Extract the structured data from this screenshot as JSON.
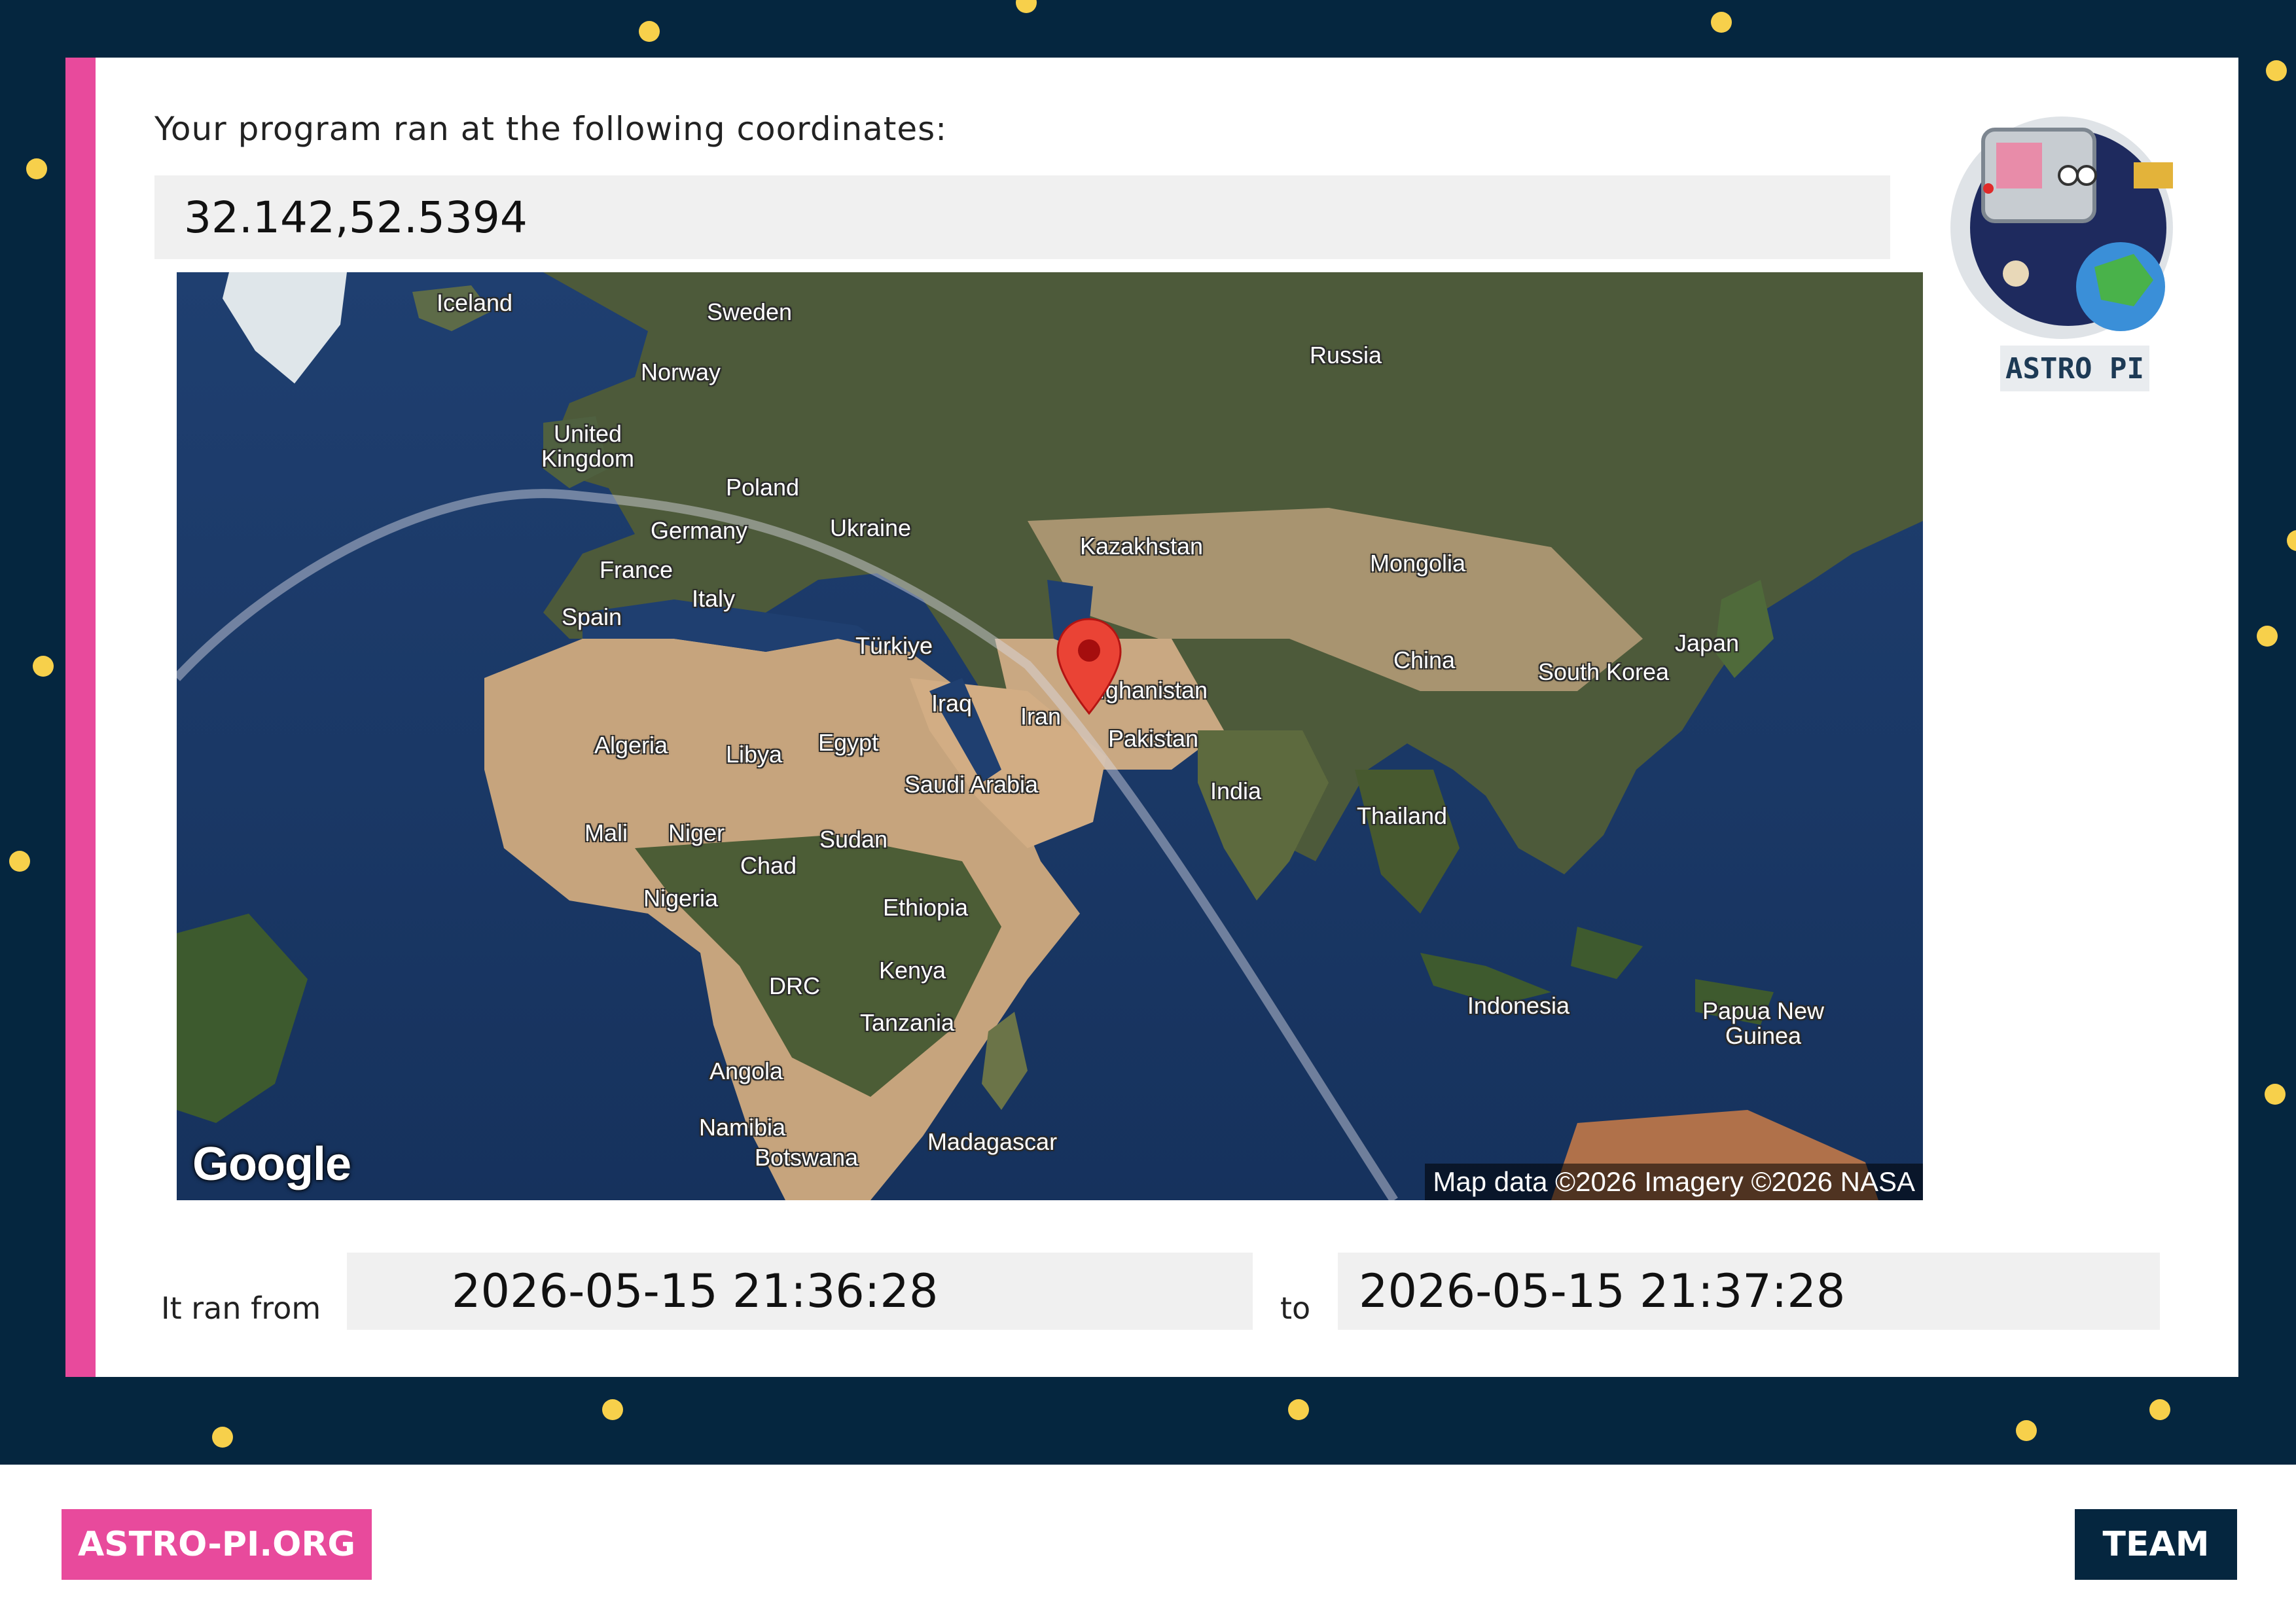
{
  "coordinates": {
    "label": "Your program ran at the following coordinates:",
    "value": "32.142,52.5394"
  },
  "map": {
    "provider_logo": "Google",
    "attribution": "Map data ©2026 Imagery ©2026 NASA",
    "marker_icon": "map-pin-icon",
    "marker_color": "#ea4335",
    "labels": {
      "iceland": "Iceland",
      "sweden": "Sweden",
      "norway": "Norway",
      "united_kingdom": "United\nKingdom",
      "poland": "Poland",
      "ukraine": "Ukraine",
      "germany": "Germany",
      "france": "France",
      "italy": "Italy",
      "spain": "Spain",
      "turkiye": "Türkiye",
      "russia": "Russia",
      "kazakhstan": "Kazakhstan",
      "mongolia": "Mongolia",
      "china": "China",
      "japan": "Japan",
      "south_korea": "South Korea",
      "afghanistan": "Afghanistan",
      "pakistan": "Pakistan",
      "iraq": "Iraq",
      "iran": "Iran",
      "india": "India",
      "thailand": "Thailand",
      "algeria": "Algeria",
      "libya": "Libya",
      "egypt": "Egypt",
      "saudi_arabia": "Saudi Arabia",
      "mali": "Mali",
      "niger": "Niger",
      "chad": "Chad",
      "sudan": "Sudan",
      "nigeria": "Nigeria",
      "ethiopia": "Ethiopia",
      "drc": "DRC",
      "kenya": "Kenya",
      "tanzania": "Tanzania",
      "angola": "Angola",
      "namibia": "Namibia",
      "botswana": "Botswana",
      "madagascar": "Madagascar",
      "indonesia": "Indonesia",
      "papua_new_guinea": "Papua New\nGuinea"
    }
  },
  "logo": {
    "text": "ASTRO PI",
    "icon": "astro-pi-logo-icon"
  },
  "timing": {
    "from_label": "It ran from",
    "from_value": "2026-05-15 21:36:28",
    "to_label": "to",
    "to_value": "2026-05-15 21:37:28"
  },
  "footer": {
    "url": "ASTRO-PI.ORG",
    "team": "TEAM"
  },
  "colors": {
    "background": "#05263f",
    "accent_pink": "#e84a9c",
    "star": "#f7d04b"
  }
}
